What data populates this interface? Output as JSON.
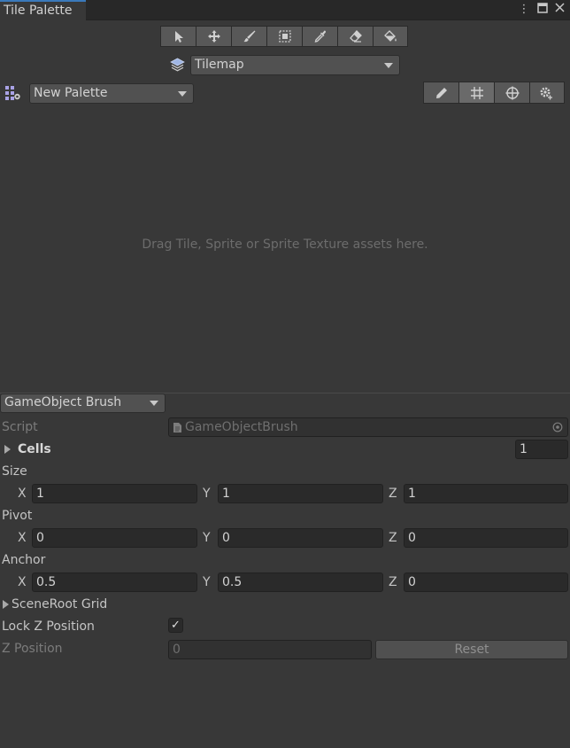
{
  "window": {
    "tab_title": "Tile Palette",
    "icons": [
      "more-vert-icon",
      "maximize-icon",
      "close-icon"
    ]
  },
  "toolbar": {
    "tools": [
      "select-icon",
      "move-icon",
      "paint-brush-icon",
      "box-fill-icon",
      "picker-icon",
      "eraser-icon",
      "fill-bucket-icon"
    ]
  },
  "active_tilemap": {
    "value": "Tilemap"
  },
  "palette": {
    "value": "New Palette"
  },
  "palette_tools": [
    "edit-pencil-icon",
    "grid-icon",
    "gizmo-icon",
    "settings-gear-icon"
  ],
  "drop_area": {
    "hint": "Drag Tile, Sprite or Sprite Texture assets here."
  },
  "brush": {
    "selected": "GameObject Brush",
    "script_label": "Script",
    "script_value": "GameObjectBrush",
    "cells_label": "Cells",
    "cells_value": "1",
    "size_label": "Size",
    "size": {
      "x": "1",
      "y": "1",
      "z": "1"
    },
    "pivot_label": "Pivot",
    "pivot": {
      "x": "0",
      "y": "0",
      "z": "0"
    },
    "anchor_label": "Anchor",
    "anchor": {
      "x": "0.5",
      "y": "0.5",
      "z": "0"
    },
    "axis_labels": {
      "x": "X",
      "y": "Y",
      "z": "Z"
    },
    "scene_root_label": "SceneRoot Grid",
    "lock_z_label": "Lock Z Position",
    "lock_z_checked": "✓",
    "z_position_label": "Z Position",
    "z_position_value": "0",
    "reset_label": "Reset"
  }
}
